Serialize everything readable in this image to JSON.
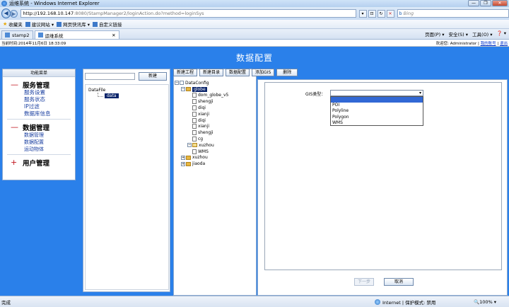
{
  "browser": {
    "window_title": "运维系统 - Windows Internet Explorer",
    "url_host": "http://192.168.10.147",
    "url_path": ":8080/StampManager2/loginAction.do?method=loginSys",
    "search_placeholder": "Bing",
    "favorites_label": "收藏夹",
    "fav_items": [
      "建议网站 ▾",
      "网页快讯库 ▾",
      "自定义链接"
    ],
    "tabs": [
      "stamp2",
      "运维系统"
    ],
    "commands": [
      "页面(P) ▾",
      "安全(S) ▾",
      "工具(O) ▾",
      "❓ ▾"
    ],
    "status_left": "完成",
    "status_zone": "Internet | 保护模式: 禁用",
    "zoom": "🔍100% ▾"
  },
  "app": {
    "current_time": "当前时间:2014年11月6日  18:33:09",
    "welcome": "欢迎您: Administrator",
    "my_account": "我的账号",
    "logout": "退出",
    "banner_title": "数据配置"
  },
  "sidebar": {
    "title": "功能菜单",
    "groups": [
      {
        "sign": "—",
        "label": "服务管理",
        "items": [
          "服务设置",
          "服务状态",
          "IP过滤",
          "数据库信息"
        ]
      },
      {
        "sign": "—",
        "label": "数据管理",
        "items": [
          "数据管理",
          "数据配置",
          "运动物体"
        ]
      },
      {
        "sign": "+",
        "label": "用户管理",
        "items": []
      }
    ]
  },
  "left_panel": {
    "new_button": "新建",
    "tree_root": "DataFile",
    "tree_child": "data"
  },
  "toolbar": {
    "buttons": [
      "新建工程",
      "新建目录",
      "数据配置",
      "添加GIS",
      "删除"
    ]
  },
  "tree": {
    "root": "DataConfig",
    "globe": "globe",
    "globe_children": [
      "dom_globe_v5",
      "shengji",
      "diqi",
      "xianji",
      "diqi",
      "xianji",
      "shengji",
      "cg"
    ],
    "xuzhou": "xuzhou",
    "xuzhou_children": [
      "WMS"
    ],
    "xuzhou2": "xuzhou",
    "jiaoda": "jiaoda"
  },
  "form": {
    "gis_label": "GIS类型：",
    "gis_options": [
      "",
      "POI",
      "Polyline",
      "Polygon",
      "WMS"
    ],
    "next_button": "下一步",
    "cancel_button": "取消"
  }
}
